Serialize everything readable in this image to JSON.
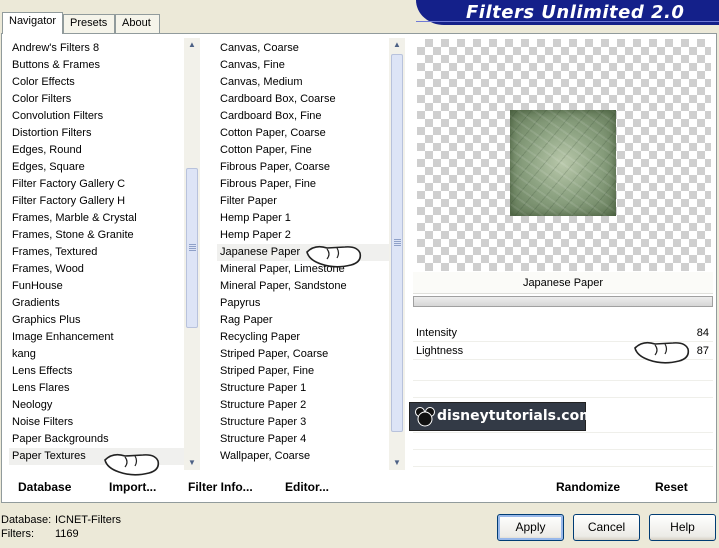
{
  "tabs": [
    {
      "label": "Navigator",
      "active": true
    },
    {
      "label": "Presets",
      "active": false
    },
    {
      "label": "About",
      "active": false
    }
  ],
  "app_title": "Filters Unlimited 2.0",
  "categories": [
    "Andrew's Filters 8",
    "Buttons & Frames",
    "Color Effects",
    "Color Filters",
    "Convolution Filters",
    "Distortion Filters",
    "Edges, Round",
    "Edges, Square",
    "Filter Factory Gallery C",
    "Filter Factory Gallery H",
    "Frames, Marble & Crystal",
    "Frames, Stone & Granite",
    "Frames, Textured",
    "Frames, Wood",
    "FunHouse",
    "Gradients",
    "Graphics Plus",
    "Image Enhancement",
    "kang",
    "Lens Effects",
    "Lens Flares",
    "Neology",
    "Noise Filters",
    "Paper Backgrounds",
    "Paper Textures"
  ],
  "selected_category": "Paper Textures",
  "filters": [
    "Canvas, Coarse",
    "Canvas, Fine",
    "Canvas, Medium",
    "Cardboard Box, Coarse",
    "Cardboard Box, Fine",
    "Cotton Paper, Coarse",
    "Cotton Paper, Fine",
    "Fibrous Paper, Coarse",
    "Fibrous Paper, Fine",
    "Filter Paper",
    "Hemp Paper 1",
    "Hemp Paper 2",
    "Japanese Paper",
    "Mineral Paper, Limestone",
    "Mineral Paper, Sandstone",
    "Papyrus",
    "Rag Paper",
    "Recycling Paper",
    "Striped Paper, Coarse",
    "Striped Paper, Fine",
    "Structure Paper 1",
    "Structure Paper 2",
    "Structure Paper 3",
    "Structure Paper 4",
    "Wallpaper, Coarse"
  ],
  "selected_filter": "Japanese Paper",
  "preview": {
    "filter_name": "Japanese Paper"
  },
  "params": [
    {
      "label": "Intensity",
      "value": "84"
    },
    {
      "label": "Lightness",
      "value": "87"
    }
  ],
  "watermark": "disneytutorials.com",
  "buttons": {
    "database": "Database",
    "import": "Import...",
    "filter_info": "Filter Info...",
    "editor": "Editor...",
    "randomize": "Randomize",
    "reset": "Reset",
    "apply": "Apply",
    "cancel": "Cancel",
    "help": "Help"
  },
  "status": {
    "database_label": "Database:",
    "database_value": "ICNET-Filters",
    "filters_label": "Filters:",
    "filters_value": "1169"
  },
  "colors": {
    "banner": "#14208a",
    "window": "#ece9d8",
    "preview_paper": "#8da382"
  }
}
